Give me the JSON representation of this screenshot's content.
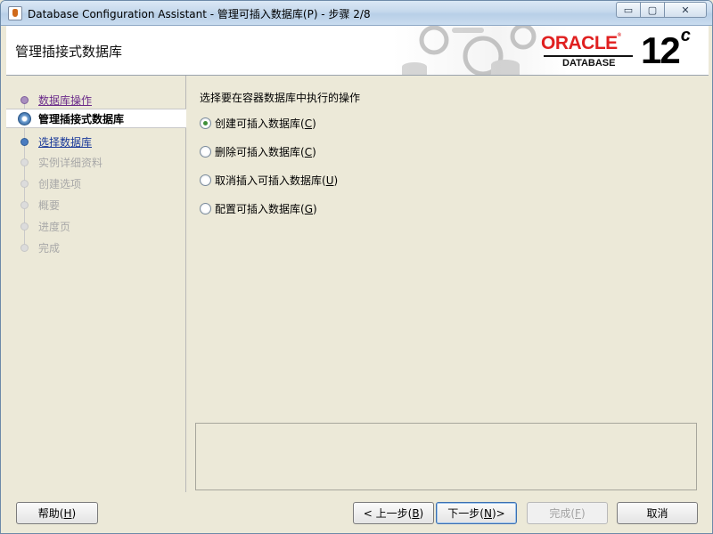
{
  "window": {
    "title": "Database Configuration Assistant - 管理可插入数据库(P) - 步骤 2/8",
    "controls": {
      "minimize": "▭",
      "maximize": "▢",
      "close": "✕"
    }
  },
  "banner": {
    "title": "管理插接式数据库",
    "logo_oracle": "ORACLE",
    "logo_database": "DATABASE",
    "version": "12",
    "version_suffix": "c"
  },
  "nav": {
    "items": [
      {
        "label": "数据库操作",
        "state": "done"
      },
      {
        "label": "管理插接式数据库",
        "state": "current"
      },
      {
        "label": "选择数据库",
        "state": "next"
      },
      {
        "label": "实例详细资料",
        "state": "disabled"
      },
      {
        "label": "创建选项",
        "state": "disabled"
      },
      {
        "label": "概要",
        "state": "disabled"
      },
      {
        "label": "进度页",
        "state": "disabled"
      },
      {
        "label": "完成",
        "state": "disabled"
      }
    ]
  },
  "main": {
    "prompt": "选择要在容器数据库中执行的操作",
    "options": [
      {
        "label": "创建可插入数据库",
        "mnemonic": "C",
        "checked": true
      },
      {
        "label": "删除可插入数据库",
        "mnemonic": "C",
        "checked": false
      },
      {
        "label": "取消插入可插入数据库",
        "mnemonic": "U",
        "checked": false
      },
      {
        "label": "配置可插入数据库",
        "mnemonic": "G",
        "checked": false
      }
    ]
  },
  "buttons": {
    "help": {
      "label": "帮助",
      "mnemonic": "H"
    },
    "back": {
      "prefix": "< 上一步",
      "mnemonic": "B"
    },
    "next": {
      "prefix": "下一步",
      "mnemonic": "N",
      "suffix": " >"
    },
    "finish": {
      "label": "完成",
      "mnemonic": "F"
    },
    "cancel": {
      "label": "取消"
    }
  },
  "colors": {
    "oracle_red": "#e02020",
    "done_link": "#6b2b8a",
    "next_link": "#1a3a9a",
    "disabled_text": "#a8a8a8",
    "radio_checked": "#3f8f3a"
  }
}
